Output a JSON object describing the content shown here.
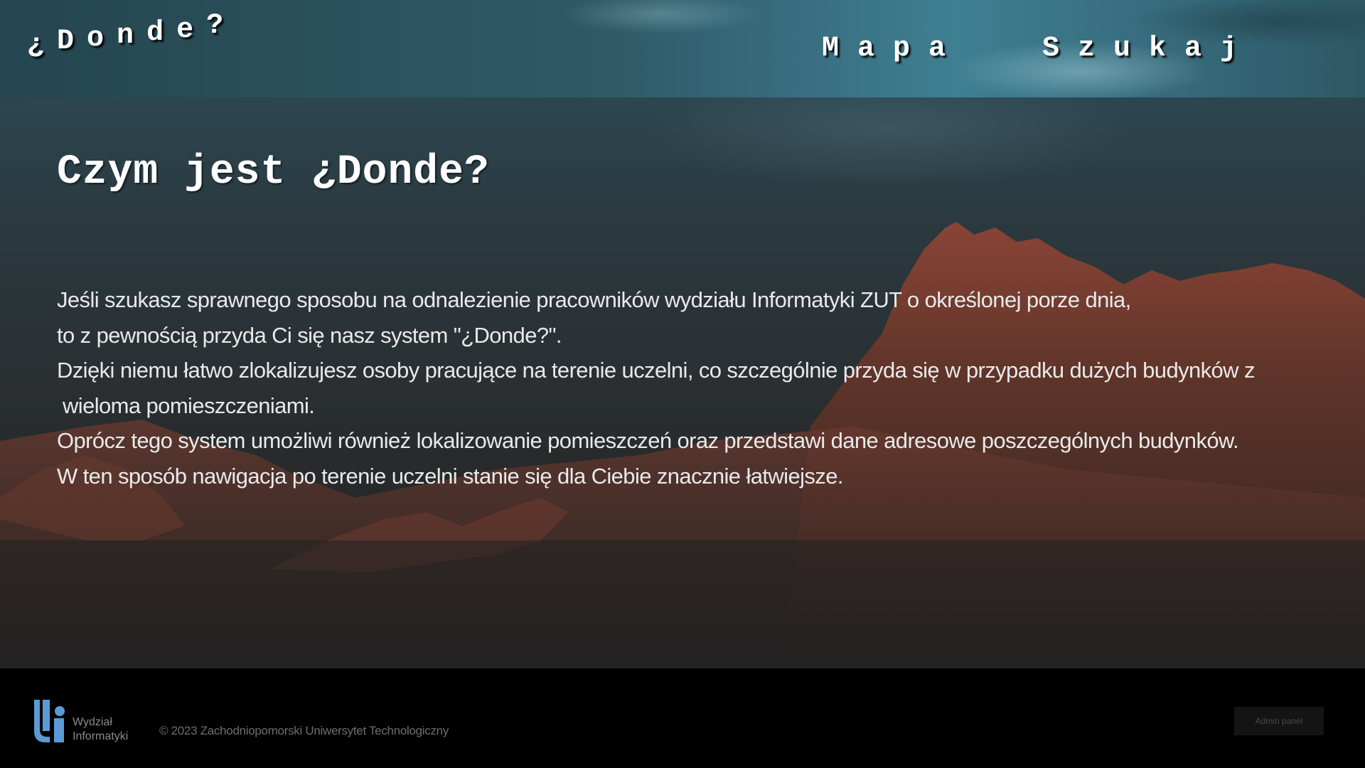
{
  "header": {
    "logo_chars": [
      "¿",
      "D",
      "o",
      "n",
      "d",
      "e",
      "?"
    ],
    "nav": [
      {
        "label": "Mapa"
      },
      {
        "label": "Szukaj"
      }
    ]
  },
  "main": {
    "title": "Czym jest ¿Donde?",
    "paragraphs": [
      "Jeśli szukasz sprawnego sposobu na odnalezienie pracowników wydziału Informatyki ZUT o określonej porze dnia,",
      "to z pewnością przyda Ci się nasz system \"¿Donde?\".",
      "Dzięki niemu łatwo zlokalizujesz osoby pracujące na terenie uczelni, co szczególnie przyda się w przypadku dużych budynków z",
      " wieloma pomieszczeniami.",
      "Oprócz tego system umożliwi również lokalizowanie pomieszczeń oraz przedstawi dane adresowe poszczególnych budynków.",
      "W ten sposób nawigacja po terenie uczelni stanie się dla Ciebie znacznie łatwiejsze."
    ]
  },
  "footer": {
    "logo_line1": "Wydział",
    "logo_line2": "Informatyki",
    "copyright": "© 2023 Zachodniopomorski Uniwersytet Technologiczny",
    "admin_label": "Admin panel"
  },
  "colors": {
    "footer_bg": "#000000",
    "logo_blue": "#5b9bd5",
    "text": "#ffffff"
  }
}
